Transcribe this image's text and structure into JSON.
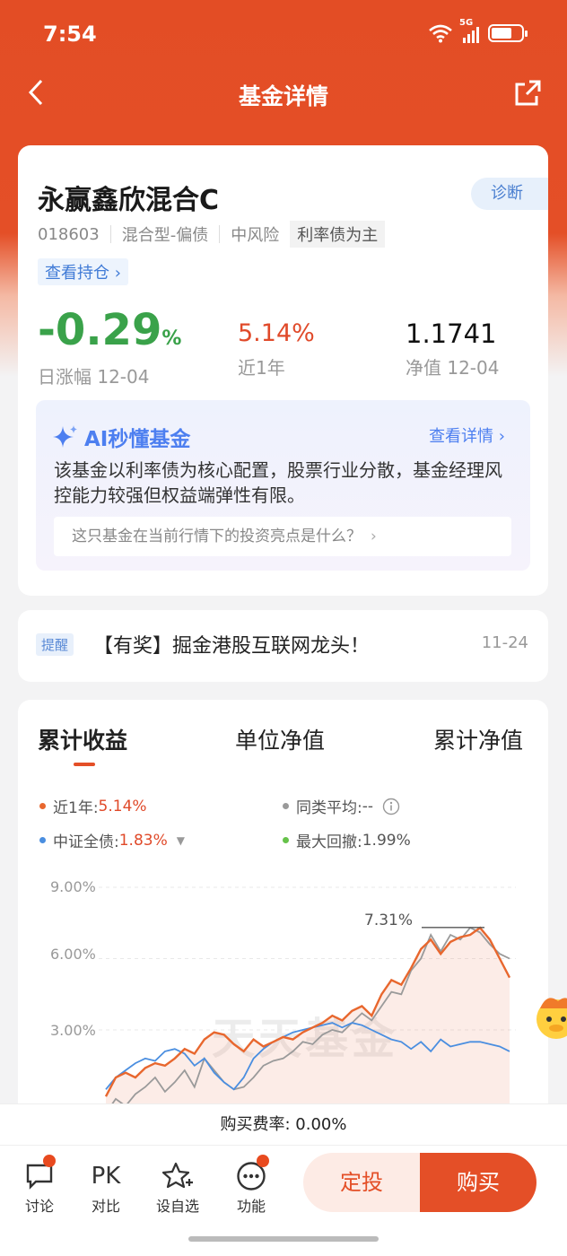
{
  "status_bar": {
    "time": "7:54",
    "network": "5G"
  },
  "nav": {
    "title": "基金详情"
  },
  "fund": {
    "name": "永赢鑫欣混合C",
    "code": "018603",
    "type": "混合型-偏债",
    "risk": "中风险",
    "tag": "利率债为主",
    "diagnose_label": "诊断",
    "holdings_label": "查看持仓 ›",
    "daily_change": "-0.29",
    "daily_change_unit": "%",
    "daily_change_label": "日涨幅 12-04",
    "year_return": "5.14%",
    "year_return_label": "近1年",
    "nav_value": "1.1741",
    "nav_label": "净值 12-04"
  },
  "ai": {
    "title": "AI秒懂基金",
    "more": "查看详情",
    "desc": "该基金以利率债为核心配置，股票行业分散，基金经理风控能力较强但权益端弹性有限。",
    "question": "这只基金在当前行情下的投资亮点是什么？"
  },
  "reminder": {
    "tag": "提醒",
    "text": "【有奖】掘金港股互联网龙头！",
    "date": "11-24"
  },
  "chart_section": {
    "tabs": [
      "累计收益",
      "单位净值",
      "累计净值"
    ],
    "legend": {
      "year_label": "近1年:",
      "year_value": "5.14%",
      "avg_label": "同类平均:",
      "avg_value": "--",
      "bench_label": "中证全债:",
      "bench_value": "1.83%",
      "drawdown_label": "最大回撤:",
      "drawdown_value": "1.99%"
    },
    "y_ticks": [
      "9.00%",
      "6.00%",
      "3.00%"
    ],
    "peak_label": "7.31%",
    "watermark": "天天基金",
    "colors": {
      "fund": "#e8672e",
      "avg": "#9a9a9a",
      "bench": "#4a8ee0",
      "drawdown": "#66c24a"
    }
  },
  "chart_data": {
    "type": "line",
    "ylim": [
      0,
      9
    ],
    "y_ticks": [
      3,
      6,
      9
    ],
    "series": [
      {
        "name": "近1年",
        "values": [
          0.2,
          1.0,
          1.2,
          1.0,
          1.4,
          1.6,
          1.5,
          1.8,
          2.2,
          2.0,
          2.6,
          2.9,
          2.8,
          2.4,
          2.1,
          2.6,
          2.3,
          2.5,
          2.7,
          2.6,
          2.9,
          3.1,
          3.3,
          3.6,
          3.4,
          3.8,
          4.0,
          3.6,
          4.5,
          5.1,
          4.9,
          5.6,
          6.4,
          6.8,
          6.2,
          6.7,
          6.9,
          7.0,
          7.3,
          6.8,
          6.0,
          5.2
        ]
      },
      {
        "name": "同类平均",
        "values": [
          -0.5,
          0.1,
          -0.2,
          0.3,
          0.6,
          1.0,
          0.4,
          0.8,
          1.3,
          0.6,
          1.8,
          1.3,
          0.8,
          0.5,
          0.6,
          1.0,
          1.5,
          1.7,
          1.8,
          2.1,
          2.5,
          2.4,
          2.8,
          3.0,
          2.9,
          3.3,
          3.7,
          3.4,
          4.0,
          4.6,
          4.5,
          5.5,
          6.0,
          7.0,
          6.3,
          7.0,
          6.8,
          7.3,
          7.1,
          6.6,
          6.2,
          6.0
        ]
      },
      {
        "name": "中证全债",
        "values": [
          0.5,
          1.0,
          1.3,
          1.6,
          1.8,
          1.7,
          2.1,
          2.2,
          2.0,
          1.5,
          1.8,
          1.2,
          0.8,
          0.5,
          1.0,
          1.8,
          2.2,
          2.5,
          2.7,
          2.9,
          3.0,
          3.1,
          3.2,
          3.3,
          3.1,
          3.3,
          3.2,
          3.0,
          2.8,
          2.6,
          2.5,
          2.2,
          2.5,
          2.1,
          2.6,
          2.3,
          2.4,
          2.5,
          2.5,
          2.4,
          2.3,
          2.1
        ]
      }
    ]
  },
  "fee": {
    "label": "购买费率: 0.00%"
  },
  "bottom_bar": {
    "discuss": "讨论",
    "pk_icon": "PK",
    "compare": "对比",
    "watchlist": "设自选",
    "more": "功能",
    "dingtou": "定投",
    "buy": "购买"
  }
}
